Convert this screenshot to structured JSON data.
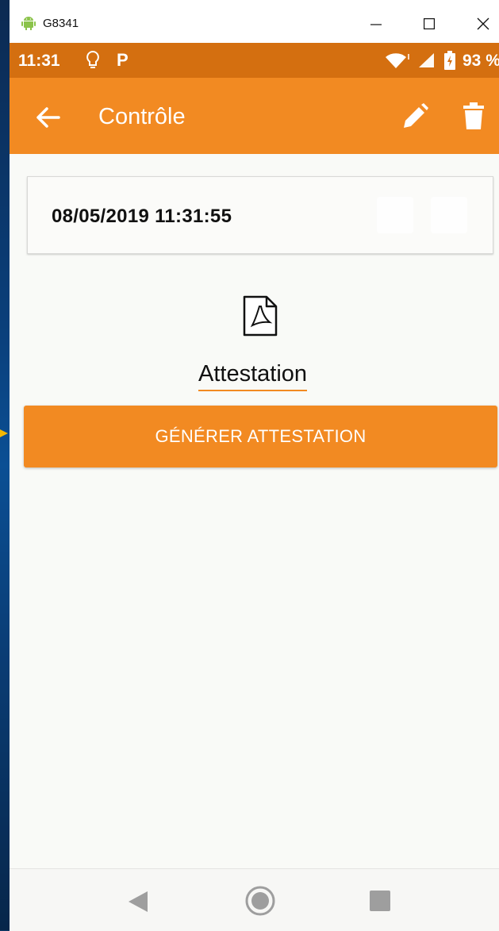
{
  "window": {
    "title": "G8341"
  },
  "status_bar": {
    "time": "11:31",
    "notification_letter": "P",
    "battery_percent": "93 %"
  },
  "app_bar": {
    "title": "Contrôle"
  },
  "card": {
    "datetime": "08/05/2019 11:31:55"
  },
  "attachment": {
    "label": "Attestation",
    "icon": "pdf-file-icon"
  },
  "actions": {
    "generate_label": "GÉNÉRER ATTESTATION"
  },
  "colors": {
    "primary": "#f28a22",
    "status_bar": "#d46f10",
    "background": "#f9faf7"
  },
  "icons": {
    "back": "arrow-left-icon",
    "edit": "pencil-icon",
    "delete": "trash-icon",
    "nav_back": "triangle-back-icon",
    "nav_home": "circle-home-icon",
    "nav_recent": "square-recents-icon"
  }
}
